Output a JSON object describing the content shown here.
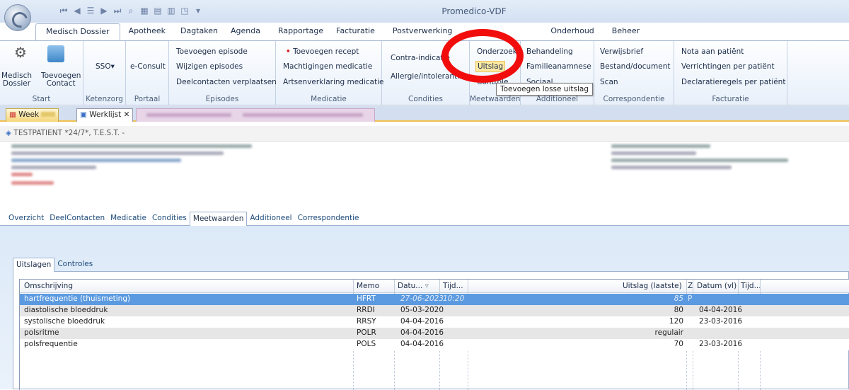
{
  "app": {
    "title": "Promedico-VDF"
  },
  "ribbon_tabs": [
    "Medisch Dossier",
    "Apotheek",
    "Dagtaken",
    "Agenda",
    "Rapportage",
    "Facturatie",
    "Postverwerking",
    "Onderhoud",
    "Beheer"
  ],
  "ribbon": {
    "start": {
      "b1": [
        "Medisch",
        "Dossier"
      ],
      "b2": [
        "Toevoegen",
        "Contact"
      ],
      "label": "Start"
    },
    "ketenzorg": {
      "b1": "SSO",
      "label": "Ketenzorg"
    },
    "portaal": {
      "b1": "e-Consult",
      "label": "Portaal"
    },
    "episodes": {
      "items": [
        "Toevoegen episode",
        "Wijzigen episodes",
        "Deelcontacten verplaatsen"
      ],
      "label": "Episodes"
    },
    "medicatie": {
      "items": [
        "Toevoegen recept",
        "Machtigingen medicatie",
        "Artsenverklaring medicatie"
      ],
      "label": "Medicatie"
    },
    "condities": {
      "items": [
        "Contra-indicatie",
        "Allergie/intolerantie"
      ],
      "label": "Condities"
    },
    "meetwaarden": {
      "items": [
        "Onderzoek",
        "Uitslag",
        "Controle"
      ],
      "label": "Meetwaarden"
    },
    "additioneel": {
      "items": [
        "Behandeling",
        "Familieanamnese",
        "Sociaal"
      ],
      "label": "Additioneel"
    },
    "correspondentie": {
      "items": [
        "Verwijsbrief",
        "Bestand/document",
        "Scan"
      ],
      "label": "Correspondentie"
    },
    "facturatie": {
      "items": [
        "Nota aan patiënt",
        "Verrichtingen per patiënt",
        "Declaratieregels per patiënt"
      ],
      "label": "Facturatie"
    }
  },
  "tooltip": "Toevoegen losse uitslag",
  "doc_tabs": [
    "Week",
    "Werklijst"
  ],
  "patient": {
    "name": "TESTPATIENT *24/7*, T.E.S.T. -"
  },
  "main_tabs": [
    "Overzicht",
    "DeelContacten",
    "Medicatie",
    "Condities",
    "Meetwaarden",
    "Additioneel",
    "Correspondentie"
  ],
  "sub_tabs": [
    "Uitslagen",
    "Controles"
  ],
  "grid": {
    "headers": {
      "omschrijving": "Omschrijving",
      "memo": "Memo",
      "datum": "Datu...",
      "tijd": "Tijd...",
      "uitslag": "Uitslag (laatste)",
      "z": "Z",
      "datum_vl": "Datum (vl)",
      "tijd2": "Tijd..."
    },
    "rows": [
      {
        "omschrijving": "hartfrequentie (thuismeting)",
        "memo": "HFRT",
        "datum": "27-06-2023",
        "tijd": "10:20",
        "uitslag": "85",
        "z": "P",
        "datum_vl": ""
      },
      {
        "omschrijving": "diastolische bloeddruk",
        "memo": "RRDI",
        "datum": "05-03-2020",
        "tijd": "",
        "uitslag": "80",
        "z": "",
        "datum_vl": "04-04-2016"
      },
      {
        "omschrijving": "systolische bloeddruk",
        "memo": "RRSY",
        "datum": "04-04-2016",
        "tijd": "",
        "uitslag": "120",
        "z": "",
        "datum_vl": "23-03-2016"
      },
      {
        "omschrijving": "polsritme",
        "memo": "POLR",
        "datum": "04-04-2016",
        "tijd": "",
        "uitslag": "regulair",
        "z": "",
        "datum_vl": ""
      },
      {
        "omschrijving": "polsfrequentie",
        "memo": "POLS",
        "datum": "04-04-2016",
        "tijd": "",
        "uitslag": "70",
        "z": "",
        "datum_vl": "23-03-2016"
      }
    ]
  }
}
